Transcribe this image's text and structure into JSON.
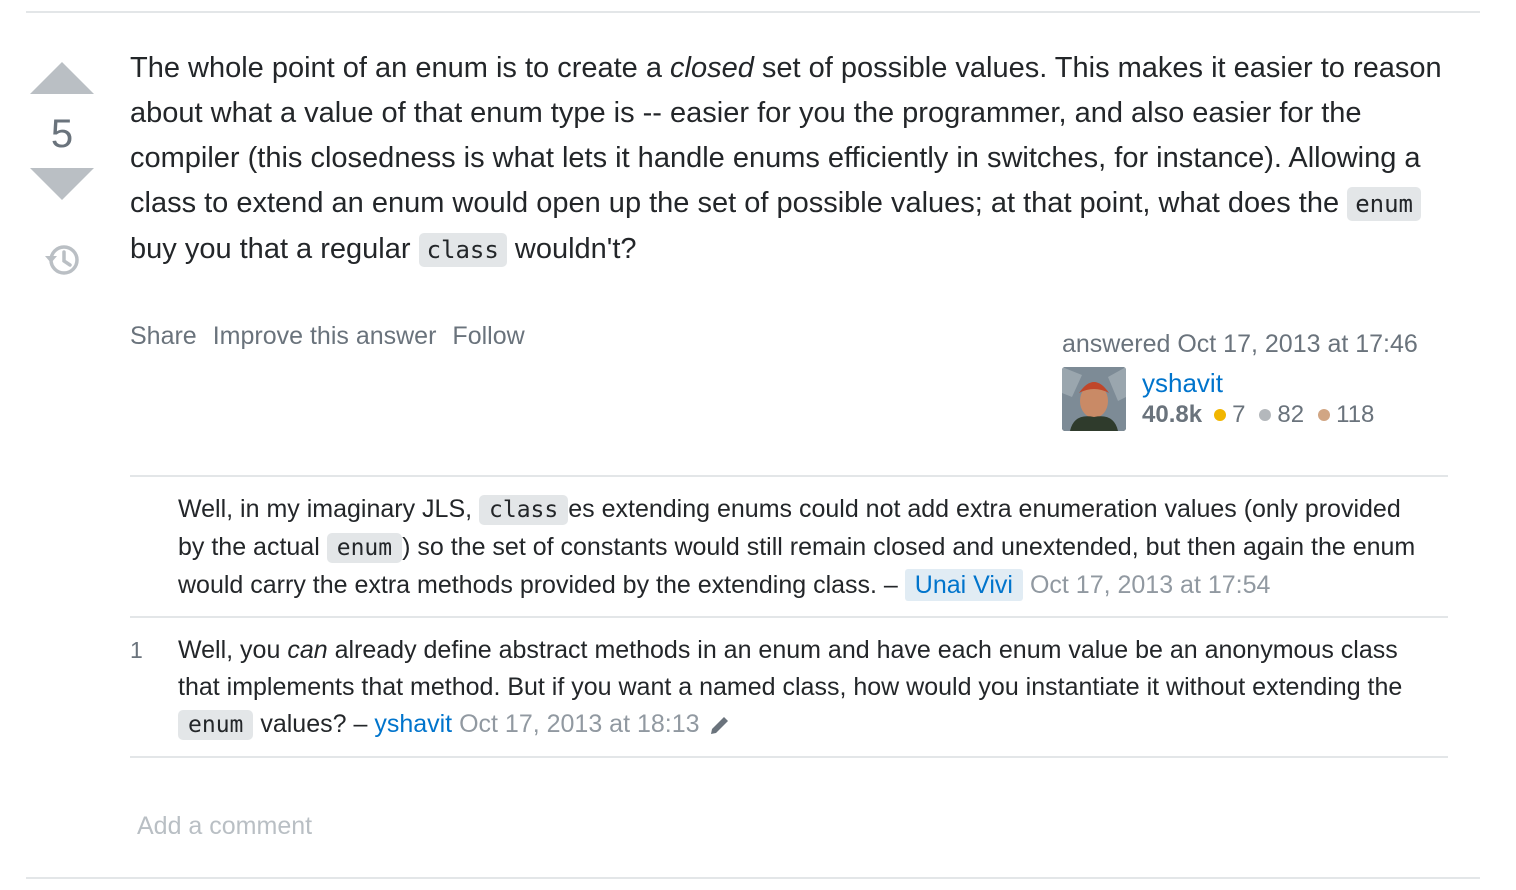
{
  "answer": {
    "score": "5",
    "body_part1": "The whole point of an enum is to create a ",
    "body_em": "closed",
    "body_part2": " set of possible values. This makes it easier to reason about what a value of that enum type is -- easier for you the programmer, and also easier for the compiler (this closedness is what lets it handle enums efficiently in switches, for instance). Allowing a class to extend an enum would open up the set of possible values; at that point, what does the ",
    "code_enum": "enum",
    "body_part3": " buy you that a regular ",
    "code_class": "class",
    "body_part4": " wouldn't?"
  },
  "menu": {
    "share": "Share",
    "improve": "Improve this answer",
    "follow": "Follow"
  },
  "signature": {
    "action": "answered Oct 17, 2013 at 17:46",
    "user_name": "yshavit",
    "reputation": "40.8k",
    "gold": "7",
    "silver": "82",
    "bronze": "118"
  },
  "comments": [
    {
      "score": "",
      "part1": "Well, in my imaginary JLS, ",
      "code1": "class",
      "part2": "es extending enums could not add extra enumeration values (only provided by the actual ",
      "code2": "enum",
      "part3": ") so the set of constants would still remain closed and unextended, but then again the enum would carry the extra methods provided by the extending class. – ",
      "user": "Unai Vivi",
      "date": "Oct 17, 2013 at 17:54"
    },
    {
      "score": "1",
      "part1": "Well, you ",
      "em": "can",
      "part2": " already define abstract methods in an enum and have each enum value be an anonymous class that implements that method. But if you want a named class, how would you instantiate it without extending the ",
      "code1": "enum",
      "part3": " values? – ",
      "user": "yshavit",
      "date": "Oct 17, 2013 at 18:13"
    }
  ],
  "add_comment": "Add a comment",
  "colors": {
    "link": "#0074cc",
    "muted": "#6a737c",
    "gold": "#f1b600",
    "silver": "#b4b8bc",
    "bronze": "#d1a684"
  }
}
